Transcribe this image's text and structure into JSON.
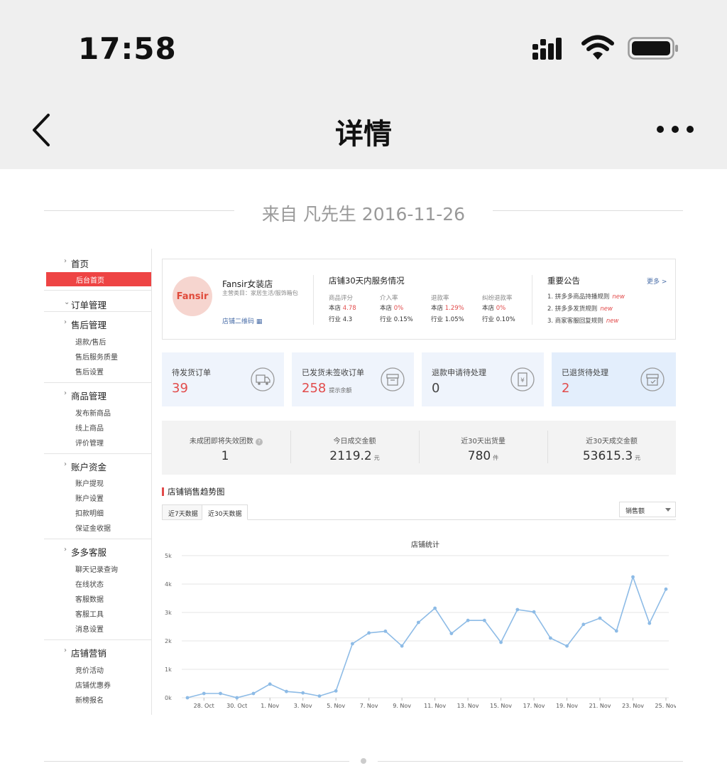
{
  "status_bar": {
    "time": "17:58"
  },
  "nav": {
    "title": "详情"
  },
  "from": {
    "text": "来自 凡先生 2016-11-26"
  },
  "sidebar": {
    "home": "首页",
    "home_active": "后台首页",
    "order_mgmt": "订单管理",
    "aftersale": {
      "title": "售后管理",
      "items": [
        "退款/售后",
        "售后服务质量",
        "售后设置"
      ]
    },
    "goods": {
      "title": "商品管理",
      "items": [
        "发布新商品",
        "线上商品",
        "评价管理"
      ]
    },
    "funds": {
      "title": "账户资金",
      "items": [
        "账户提现",
        "账户设置",
        "扣款明细",
        "保证金收据"
      ]
    },
    "cs": {
      "title": "多多客服",
      "items": [
        "聊天记录查询",
        "在线状态",
        "客服数据",
        "客服工具",
        "消息设置"
      ]
    },
    "marketing": {
      "title": "店铺营销",
      "items": [
        "竞价活动",
        "店铺优惠券",
        "新榜报名"
      ]
    }
  },
  "shop": {
    "logo_text": "Fansir",
    "name": "Fansir女装店",
    "category": "主营类目：家居生活/服饰箱包",
    "qr_label": "店铺二维码"
  },
  "service": {
    "title": "店铺30天内服务情况",
    "cols": [
      {
        "header": "商品评分",
        "store_label": "本店",
        "store_value": "4.78",
        "industry": "行业 4.3"
      },
      {
        "header": "介入率",
        "store_label": "本店",
        "store_value": "0%",
        "industry": "行业 0.15%"
      },
      {
        "header": "退款率",
        "store_label": "本店",
        "store_value": "1.29%",
        "industry": "行业 1.05%"
      },
      {
        "header": "纠纷退款率",
        "store_label": "本店",
        "store_value": "0%",
        "industry": "行业 0.10%"
      }
    ]
  },
  "announcements": {
    "title": "重要公告",
    "more": "更多 >",
    "items": [
      {
        "text": "1. 拼多多商品持播规则",
        "tag": "new"
      },
      {
        "text": "2. 拼多多发货规则",
        "tag": "new"
      },
      {
        "text": "3. 商家客服回复规则",
        "tag": "new"
      }
    ]
  },
  "stats": [
    {
      "label": "待发货订单",
      "value": "39",
      "suffix": ""
    },
    {
      "label": "已发货未签收订单",
      "value": "258",
      "suffix": "提示余额"
    },
    {
      "label": "退款申请待处理",
      "value": "0",
      "suffix": ""
    },
    {
      "label": "已退货待处理",
      "value": "2",
      "suffix": ""
    }
  ],
  "kpis": [
    {
      "label": "未成团即将失效团数",
      "value": "1",
      "unit": ""
    },
    {
      "label": "今日成交金额",
      "value": "2119.2",
      "unit": "元"
    },
    {
      "label": "近30天出货量",
      "value": "780",
      "unit": "件"
    },
    {
      "label": "近30天成交金额",
      "value": "53615.3",
      "unit": "元"
    }
  ],
  "trend": {
    "title": "店铺销售趋势图",
    "tabs": [
      "近7天数据",
      "近30天数据"
    ],
    "select": "销售额"
  },
  "chart_data": {
    "type": "line",
    "title": "店铺统计",
    "x": [
      "27. Oct",
      "28. Oct",
      "29. Oct",
      "30. Oct",
      "31. Oct",
      "1. Nov",
      "2. Nov",
      "3. Nov",
      "4. Nov",
      "5. Nov",
      "6. Nov",
      "7. Nov",
      "8. Nov",
      "9. Nov",
      "10. Nov",
      "11. Nov",
      "12. Nov",
      "13. Nov",
      "14. Nov",
      "15. Nov",
      "16. Nov",
      "17. Nov",
      "18. Nov",
      "19. Nov",
      "20. Nov",
      "21. Nov",
      "22. Nov",
      "23. Nov",
      "24. Nov",
      "25. Nov"
    ],
    "xticks": [
      "28. Oct",
      "30. Oct",
      "1. Nov",
      "3. Nov",
      "5. Nov",
      "7. Nov",
      "9. Nov",
      "11. Nov",
      "13. Nov",
      "15. Nov",
      "17. Nov",
      "19. Nov",
      "21. Nov",
      "23. Nov",
      "25. Nov"
    ],
    "values": [
      0,
      150,
      150,
      0,
      150,
      480,
      220,
      170,
      60,
      240,
      1900,
      2280,
      2340,
      1820,
      2650,
      3150,
      2260,
      2720,
      2720,
      1950,
      3100,
      3020,
      2100,
      1820,
      2580,
      2800,
      2350,
      4250,
      2620,
      3820
    ],
    "ylim": [
      0,
      5000
    ],
    "yticks": [
      "0k",
      "1k",
      "2k",
      "3k",
      "4k",
      "5k"
    ],
    "color": "#8dbbe6",
    "grid": true
  }
}
